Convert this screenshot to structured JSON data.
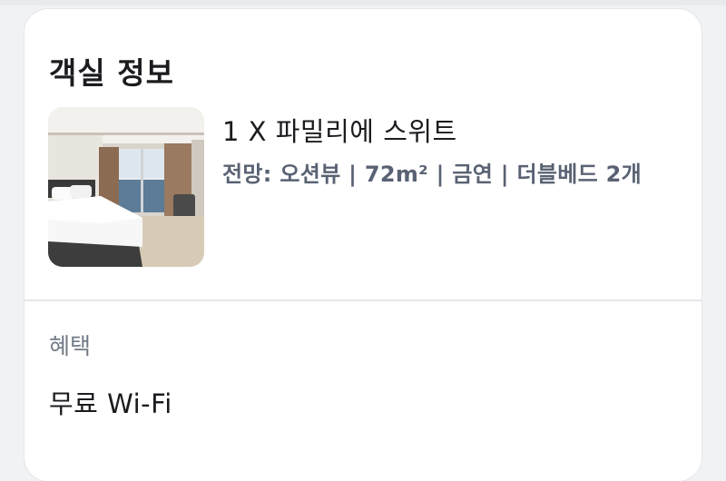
{
  "room_info": {
    "title": "객실 정보",
    "room_name": "1 X 파밀리에 스위트",
    "details": "전망: 오션뷰 | 72m² | 금연 | 더블베드 2개"
  },
  "benefits": {
    "label": "혜택",
    "items": [
      "무료 Wi-Fi"
    ]
  }
}
